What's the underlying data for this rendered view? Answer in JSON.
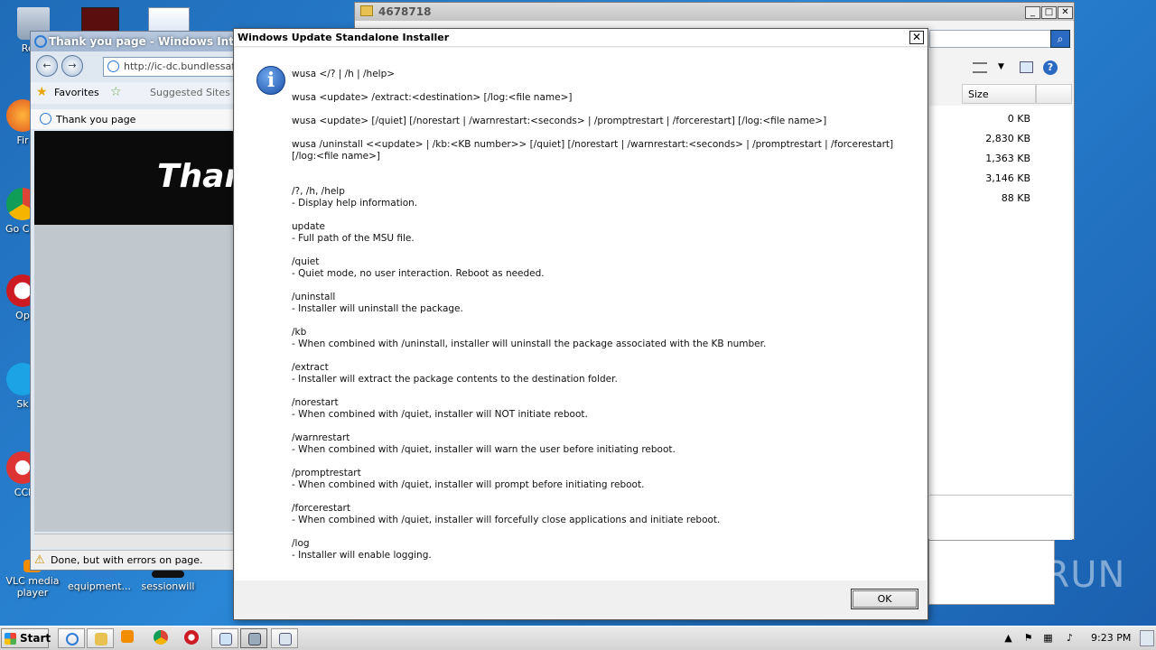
{
  "desktop": {
    "icons": [
      {
        "label": "Recy"
      },
      {
        "label": "Fir"
      },
      {
        "label": "Go Chr"
      },
      {
        "label": "Op"
      },
      {
        "label": "Sk"
      },
      {
        "label": "CCl"
      },
      {
        "label": "VLC media player"
      },
      {
        "label": "equipment..."
      },
      {
        "label": "sessionwill"
      }
    ]
  },
  "explorer": {
    "title": "4678718",
    "size_header": "Size",
    "sizes": [
      "0 KB",
      "2,830 KB",
      "1,363 KB",
      "3,146 KB",
      "88 KB"
    ]
  },
  "ie": {
    "title": "Thank you page - Windows Internet",
    "address": "http://ic-dc.bundlessafev",
    "favorites_label": "Favorites",
    "suggested_sites_label": "Suggested Sites",
    "tab_label": "Thank you page",
    "page_heading": "Than",
    "status_text": "Done, but with errors on page."
  },
  "dialog": {
    "title": "Windows Update Standalone Installer",
    "usage_lines": [
      "wusa </? | /h | /help>",
      "wusa <update> /extract:<destination> [/log:<file name>]",
      "wusa <update> [/quiet] [/norestart | /warnrestart:<seconds> | /promptrestart | /forcerestart] [/log:<file name>]",
      "wusa /uninstall <<update> | /kb:<KB number>> [/quiet] [/norestart | /warnrestart:<seconds> | /promptrestart | /forcerestart] [/log:<file name>]"
    ],
    "options": [
      {
        "name": "/?, /h, /help",
        "desc": "-  Display help information."
      },
      {
        "name": "update",
        "desc": "-  Full path of the MSU file."
      },
      {
        "name": "/quiet",
        "desc": "-  Quiet mode, no user interaction. Reboot as needed."
      },
      {
        "name": "/uninstall",
        "desc": "-  Installer will uninstall the package."
      },
      {
        "name": "/kb",
        "desc": "-  When combined with /uninstall, installer will uninstall the package associated with the KB number."
      },
      {
        "name": "/extract",
        "desc": "-  Installer will extract the package contents to the destination folder."
      },
      {
        "name": "/norestart",
        "desc": "-  When combined with /quiet, installer will NOT initiate reboot."
      },
      {
        "name": "/warnrestart",
        "desc": "-  When combined with /quiet, installer will warn the user before initiating reboot."
      },
      {
        "name": "/promptrestart",
        "desc": "-  When combined with /quiet, installer will prompt before initiating reboot."
      },
      {
        "name": "/forcerestart",
        "desc": "-  When combined with /quiet, installer will forcefully close applications and initiate reboot."
      },
      {
        "name": "/log",
        "desc": "-  Installer will enable logging."
      }
    ],
    "ok_label": "OK",
    "close_glyph": "✕"
  },
  "taskbar": {
    "start_label": "Start",
    "clock": "9:23 PM"
  },
  "watermark": "ANY▷RUN",
  "colors": {
    "desktop_blue": "#1f6bb8",
    "dialog_bg": "#f0f0f0",
    "info_icon_blue": "#1b4fa8"
  }
}
